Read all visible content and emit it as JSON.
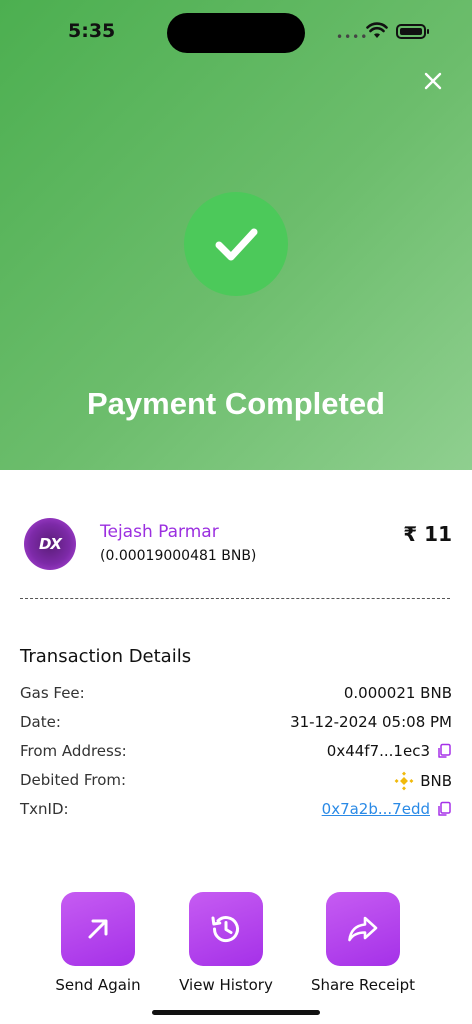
{
  "status_bar": {
    "time": "5:35"
  },
  "header": {
    "title": "Payment Completed"
  },
  "recipient": {
    "name": "Tejash Parmar",
    "crypto_amount": "(0.00019000481 BNB)",
    "fiat_amount": "₹ 11",
    "avatar_text": "DX"
  },
  "details": {
    "title": "Transaction Details",
    "rows": [
      {
        "label": "Gas Fee:",
        "value": "0.000021 BNB"
      },
      {
        "label": "Date:",
        "value": "31-12-2024 05:08 PM"
      },
      {
        "label": "From Address:",
        "value": "0x44f7...1ec3"
      },
      {
        "label": "Debited From:",
        "value": "BNB"
      },
      {
        "label": "TxnID:",
        "value": "0x7a2b...7edd"
      }
    ]
  },
  "actions": [
    {
      "label": "Send Again",
      "icon": "arrow-up-right-icon"
    },
    {
      "label": "View History",
      "icon": "history-icon"
    },
    {
      "label": "Share Receipt",
      "icon": "share-icon"
    }
  ],
  "colors": {
    "accent": "#a531e8",
    "success_green": "#4cc95a",
    "link": "#2a8ae6",
    "name_purple": "#9b2fe0"
  }
}
